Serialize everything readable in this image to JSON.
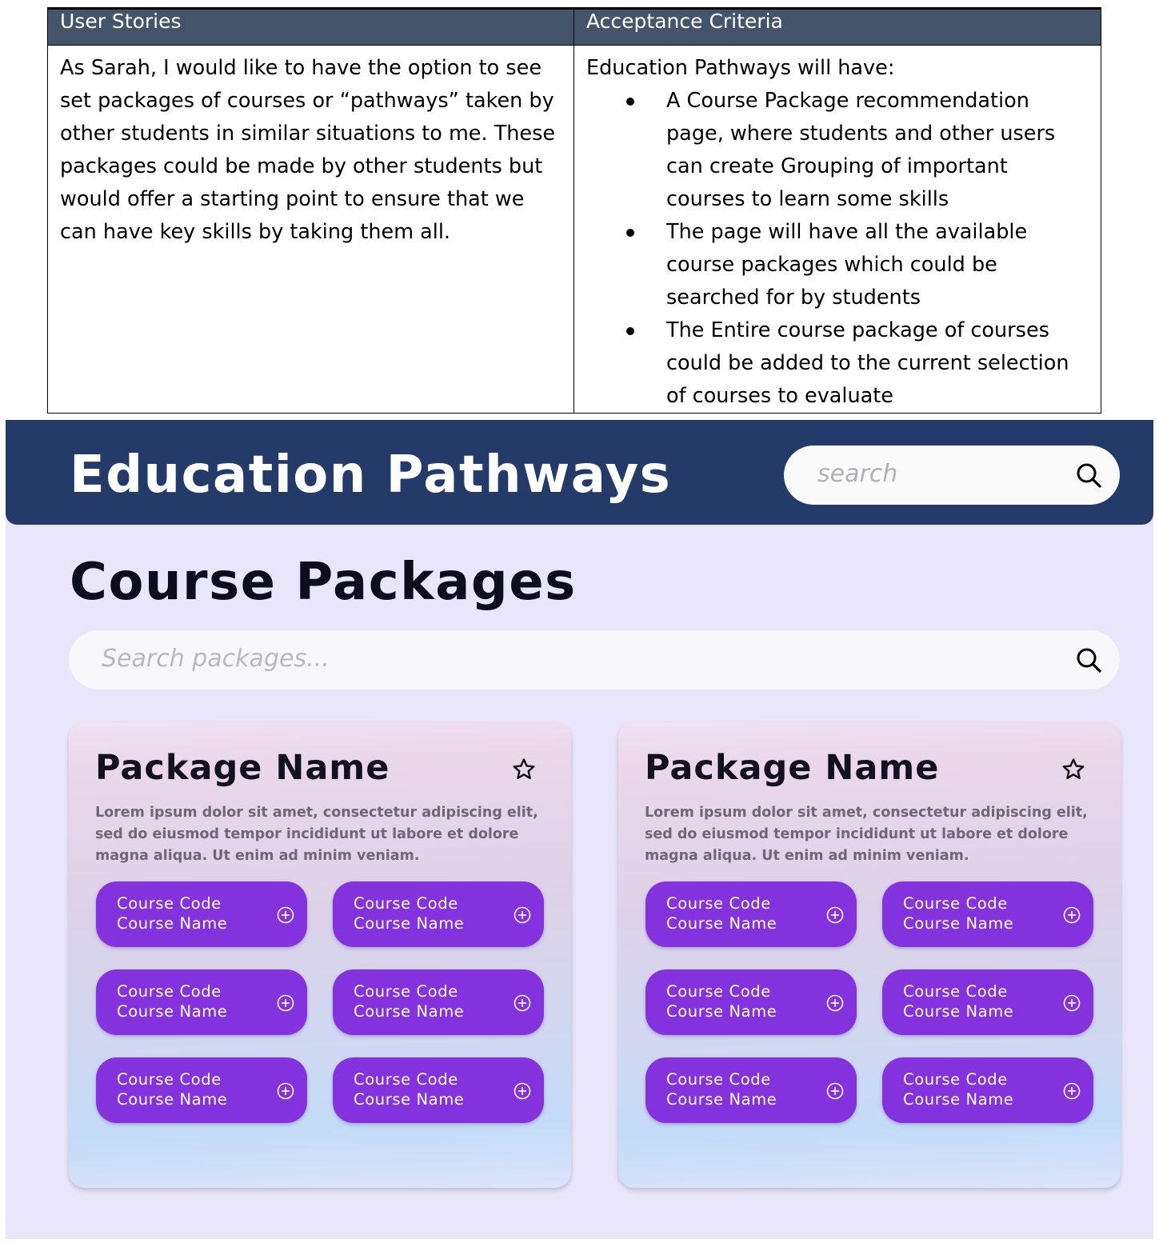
{
  "story_table": {
    "headers": {
      "user_stories": "User Stories",
      "acceptance_criteria": "Acceptance Criteria"
    },
    "user_story": "As Sarah, I would like to have the option to see set packages of courses or “pathways” taken by other students in similar situations to me. These packages could be made by other students but would offer a starting point to ensure that we can have key skills by taking them all.",
    "criteria_intro": "Education Pathways will have:",
    "criteria": [
      "A Course Package recommendation page, where students and other users can create Grouping of important courses to learn some skills",
      "The page will have all the available course packages which could be searched for by students",
      "The Entire course package of courses could be added to the current selection of courses to evaluate"
    ]
  },
  "app": {
    "title": "Education Pathways",
    "header_search_placeholder": "search",
    "page_title": "Course Packages",
    "package_search_placeholder": "Search packages...",
    "colors": {
      "header": "#243b6a",
      "background": "#e9e5fa",
      "course_button": "#8431de"
    },
    "icons": {
      "search": "search-icon",
      "favorite": "star-icon",
      "add": "plus-circle-icon"
    },
    "packages": [
      {
        "name": "Package Name",
        "description": "Lorem ipsum dolor sit amet, consectetur adipiscing elit, sed do eiusmod tempor incididunt ut labore et dolore magna aliqua. Ut enim ad minim veniam.",
        "courses": [
          {
            "code": "Course Code",
            "name": "Course Name"
          },
          {
            "code": "Course Code",
            "name": "Course Name"
          },
          {
            "code": "Course Code",
            "name": "Course Name"
          },
          {
            "code": "Course Code",
            "name": "Course Name"
          },
          {
            "code": "Course Code",
            "name": "Course Name"
          },
          {
            "code": "Course Code",
            "name": "Course Name"
          }
        ]
      },
      {
        "name": "Package Name",
        "description": "Lorem ipsum dolor sit amet, consectetur adipiscing elit, sed do eiusmod tempor incididunt ut labore et dolore magna aliqua. Ut enim ad minim veniam.",
        "courses": [
          {
            "code": "Course Code",
            "name": "Course Name"
          },
          {
            "code": "Course Code",
            "name": "Course Name"
          },
          {
            "code": "Course Code",
            "name": "Course Name"
          },
          {
            "code": "Course Code",
            "name": "Course Name"
          },
          {
            "code": "Course Code",
            "name": "Course Name"
          },
          {
            "code": "Course Code",
            "name": "Course Name"
          }
        ]
      }
    ]
  }
}
